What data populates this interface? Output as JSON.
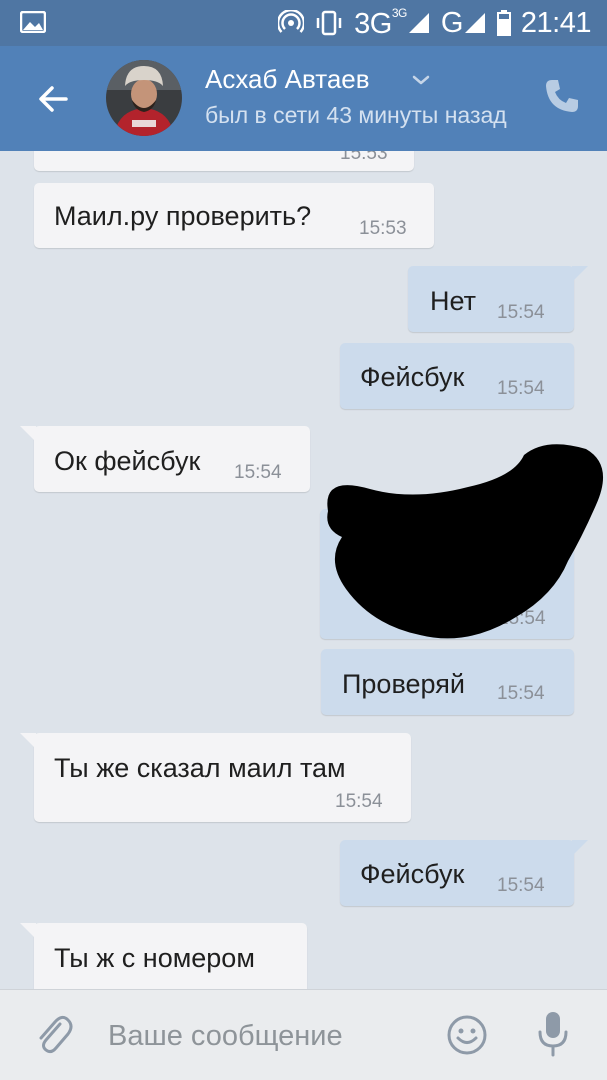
{
  "status_bar": {
    "network_label": "3G",
    "network_sup": "3G",
    "network_label_2": "G",
    "time": "21:41"
  },
  "header": {
    "contact_name": "Асхаб Автаев",
    "contact_status": "был в сети 43 минуты назад"
  },
  "messages": [
    {
      "direction": "in",
      "text": "",
      "time": "15:53"
    },
    {
      "direction": "in",
      "text": "Маил.ру проверить?",
      "time": "15:53"
    },
    {
      "direction": "out",
      "text": "Нет",
      "time": "15:54"
    },
    {
      "direction": "out",
      "text": "Фейсбук",
      "time": "15:54"
    },
    {
      "direction": "in",
      "text": "Ок фейсбук",
      "time": "15:54"
    },
    {
      "direction": "out",
      "text": "",
      "time": "15:54",
      "redacted": true
    },
    {
      "direction": "out",
      "text": "Проверяй",
      "time": "15:54"
    },
    {
      "direction": "in",
      "text": "Ты же сказал маил там",
      "time": "15:54"
    },
    {
      "direction": "out",
      "text": "Фейсбук",
      "time": "15:54"
    },
    {
      "direction": "in",
      "text": "Ты ж с номером",
      "time": ""
    }
  ],
  "composer": {
    "placeholder": "Ваше сообщение",
    "value": ""
  },
  "colors": {
    "status_bar": "#4f76a3",
    "toolbar": "#5181b8",
    "background": "#dde3ea",
    "incoming_bubble": "#f4f4f6",
    "outgoing_bubble": "#ccdbec"
  },
  "icons": {
    "status": [
      "gallery-icon",
      "hotspot-icon",
      "vibrate-icon",
      "signal-icon",
      "battery-icon"
    ],
    "toolbar": [
      "back-arrow-icon",
      "chevron-down-icon",
      "phone-icon"
    ],
    "composer": [
      "paperclip-icon",
      "emoji-icon",
      "microphone-icon"
    ]
  }
}
